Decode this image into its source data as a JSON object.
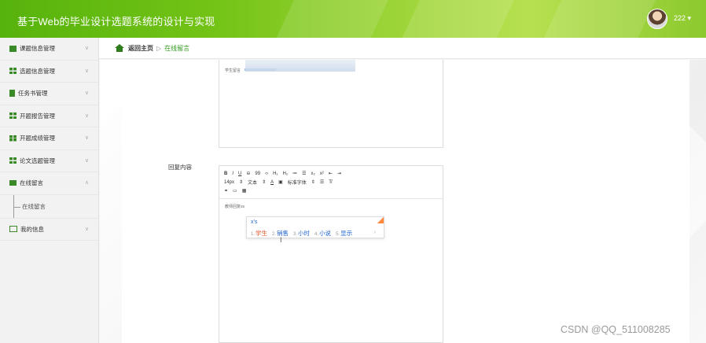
{
  "header": {
    "title": "基于Web的毕业设计选题系统的设计与实现",
    "username": "222 ▾"
  },
  "sidebar": {
    "items": [
      {
        "label": "课题信息管理",
        "icon": "teacher-icon"
      },
      {
        "label": "选题信息管理",
        "icon": "grid-icon"
      },
      {
        "label": "任务书管理",
        "icon": "document-icon"
      },
      {
        "label": "开题报告管理",
        "icon": "grid-icon"
      },
      {
        "label": "开题成绩管理",
        "icon": "grid-icon"
      },
      {
        "label": "论文选题管理",
        "icon": "grid-icon"
      },
      {
        "label": "在线留言",
        "icon": "message-icon",
        "expanded": true
      }
    ],
    "subitem": "在线留言",
    "last_item": {
      "label": "我的信息",
      "icon": "id-card-icon"
    }
  },
  "breadcrumb": {
    "home": "返回主页",
    "separator": "▷",
    "current": "在线留言"
  },
  "form": {
    "student_message_label": "学生留言",
    "reply_label": "回复内容",
    "editor_placeholder": "教师回复ss",
    "toolbar_row1": [
      "B",
      "I",
      "U",
      "⊖",
      "99",
      "‹›",
      "H₁",
      "H₂",
      "≔",
      "☰",
      "x₂",
      "x²",
      "⇤",
      "⇥"
    ],
    "toolbar_row2": [
      "14px",
      "⇕",
      "文本",
      "⇕",
      "A",
      "▣",
      "标准字体",
      "⇕",
      "☰",
      "T̸"
    ],
    "toolbar_row3": [
      "⚭",
      "▭",
      "▦"
    ]
  },
  "ime": {
    "composition": "x's",
    "candidates": [
      {
        "num": "1.",
        "text": "学生"
      },
      {
        "num": "2.",
        "text": "销售"
      },
      {
        "num": "3.",
        "text": "小时"
      },
      {
        "num": "4.",
        "text": "小说"
      },
      {
        "num": "5.",
        "text": "显示"
      }
    ],
    "more": "›"
  },
  "watermark": "CSDN @QQ_511008285",
  "colors": {
    "brand_green": "#6ABF15",
    "link_green": "#2F9A1E"
  }
}
